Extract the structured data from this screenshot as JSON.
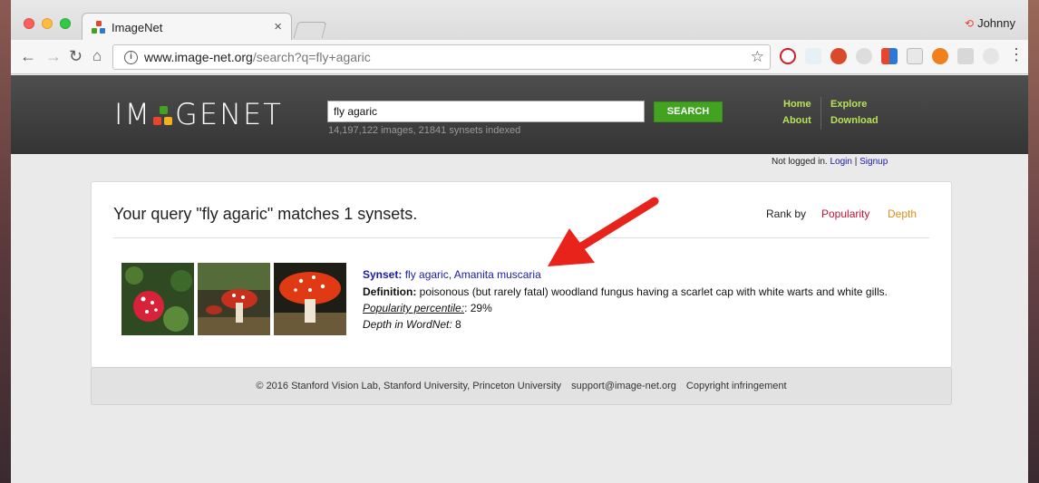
{
  "browser": {
    "tab_title": "ImageNet",
    "profile_name": "Johnny",
    "url_host": "www.image-net.org",
    "url_path": "/search?q=fly+agaric"
  },
  "site": {
    "logo_left": "IM",
    "logo_right": "GENET",
    "search_value": "fly agaric",
    "search_button": "SEARCH",
    "stats": "14,197,122 images, 21841 synsets indexed",
    "nav": {
      "home": "Home",
      "about": "About",
      "explore": "Explore",
      "download": "Download"
    },
    "login": {
      "status": "Not logged in.",
      "login": "Login",
      "sep": " | ",
      "signup": "Signup"
    }
  },
  "results": {
    "title": "Your query \"fly agaric\" matches 1 synsets.",
    "rank_by": "Rank by",
    "rank_popularity": "Popularity",
    "rank_depth": "Depth",
    "synset_label": "Synset:",
    "synset_name": " fly agaric, Amanita muscaria",
    "definition_label": "Definition:",
    "definition_text": " poisonous (but rarely fatal) woodland fungus having a scarlet cap with white warts and white gills.",
    "popularity_label": "Popularity percentile:",
    "popularity_value": ": 29%",
    "depth_label": "Depth in WordNet:",
    "depth_value": " 8"
  },
  "footer": {
    "copyright": "© 2016 Stanford Vision Lab, Stanford University, Princeton University",
    "email": "support@image-net.org",
    "infringement": "Copyright infringement"
  },
  "colors": {
    "header_bg": "#3c3c3c",
    "nav_link": "#b7e25a",
    "search_green": "#41a31f",
    "popularity": "#c41230",
    "depth": "#e38b1b",
    "annotation_arrow": "#e8231b"
  }
}
